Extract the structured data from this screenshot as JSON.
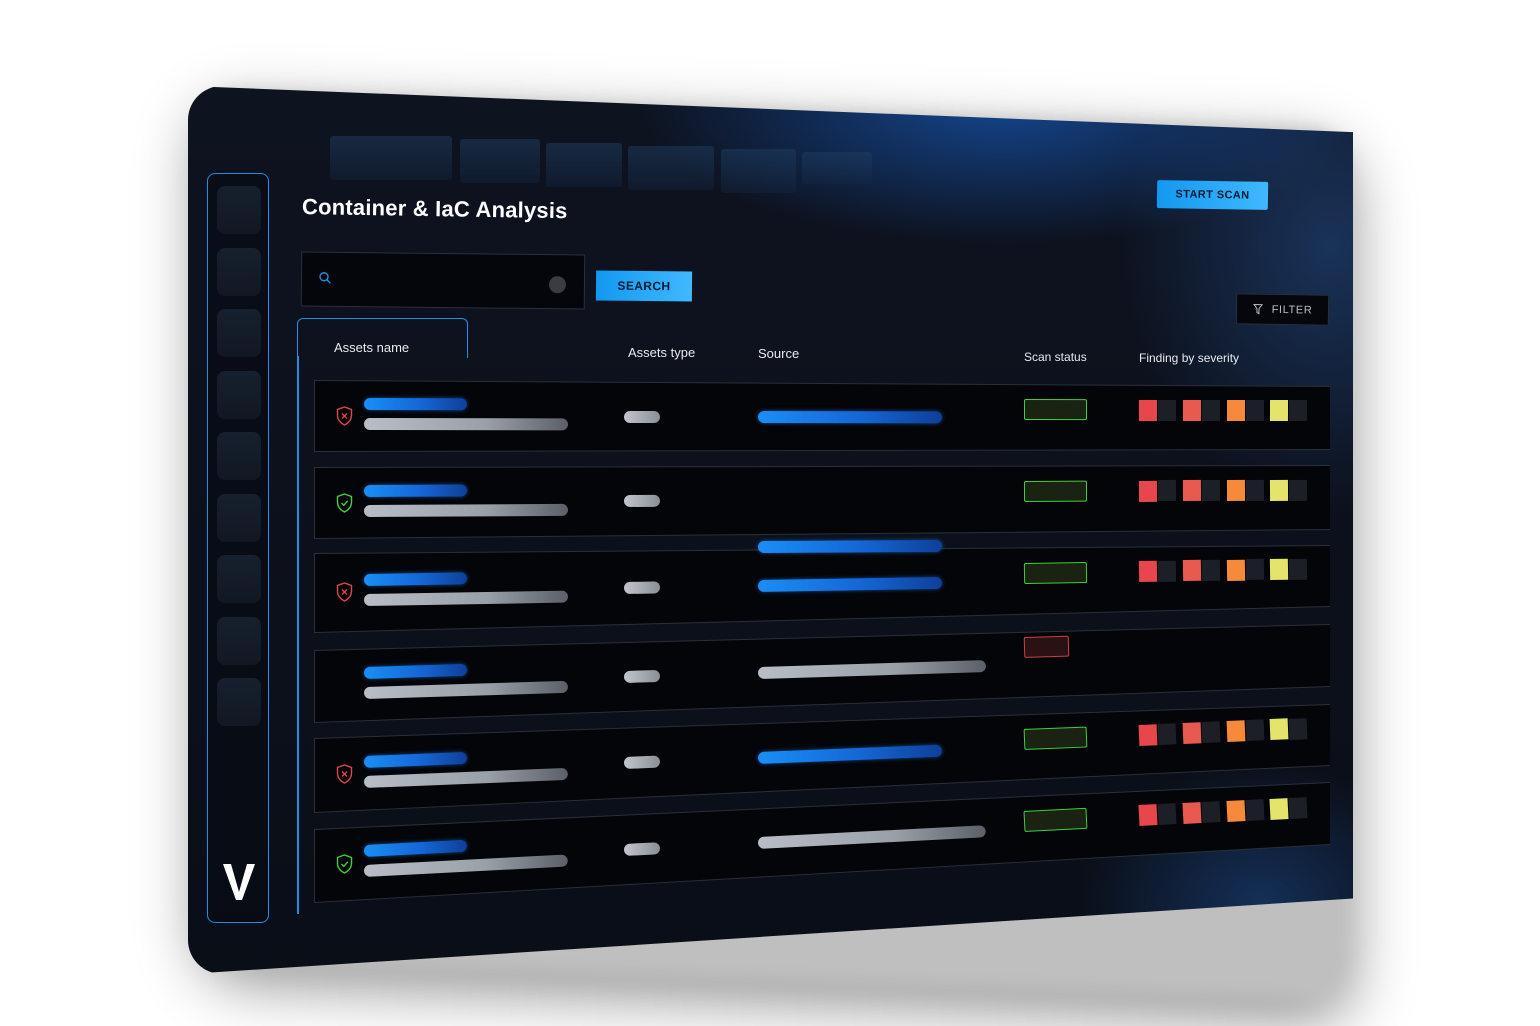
{
  "page": {
    "title": "Container & IaC Analysis"
  },
  "toolbar": {
    "start_scan_label": "START SCAN",
    "search_label": "SEARCH",
    "filter_label": "FILTER",
    "search_placeholder": ""
  },
  "table": {
    "columns": [
      "Assets name",
      "Assets type",
      "Source",
      "Scan status",
      "Finding by severity"
    ]
  },
  "colors": {
    "accent": "#1e8ee6",
    "critical": "#e8464d",
    "high": "#e85a4f",
    "medium": "#f7893a",
    "low": "#e4e46a",
    "status_ok": "#3fcf3f",
    "status_fail": "#cf3f3f"
  },
  "icons": {
    "shield_fail": "shield-x-icon",
    "shield_pass": "shield-check-icon",
    "search": "search-icon",
    "filter": "funnel-icon",
    "logo": "v-logo"
  }
}
